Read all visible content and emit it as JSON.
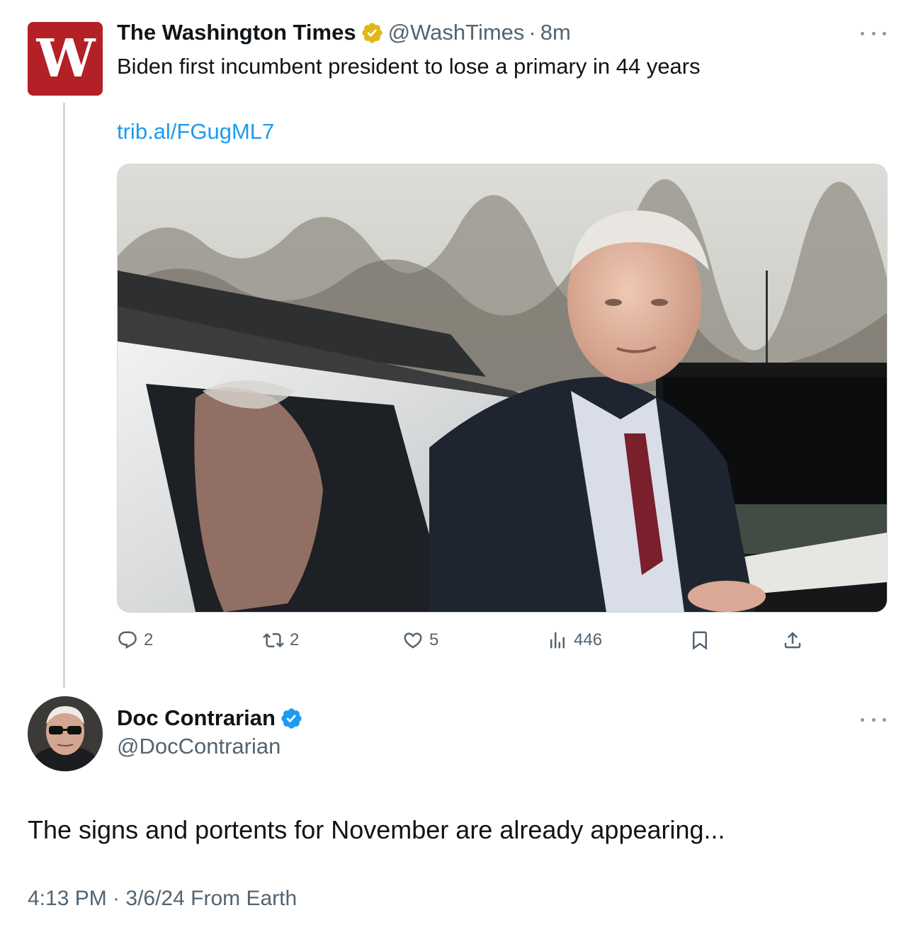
{
  "quoted_tweet": {
    "logo_icon": "washington-times-logo",
    "brand_color": "#b32025",
    "display_name": "The Washington Times",
    "verified_badge": "gold-verified-badge",
    "handle": "@WashTimes",
    "separator": "·",
    "time": "8m",
    "text": "Biden first incumbent president to lose a primary in 44 years",
    "link": "trib.al/FGugML7",
    "media_icon": "photo-man-exiting-suv",
    "actions": {
      "replies": "2",
      "reposts": "2",
      "likes": "5",
      "views": "446"
    }
  },
  "main_tweet": {
    "display_name": "Doc Contrarian",
    "verified_badge": "blue-verified-badge",
    "handle": "@DocContrarian",
    "text": "The signs and portents for November are already appearing...",
    "timestamp": "4:13 PM · 3/6/24 From Earth"
  },
  "colors": {
    "link": "#1d9bf0",
    "secondary_text": "#536471",
    "verified_blue": "#1d9bf0",
    "verified_gold": "#e2b719"
  }
}
